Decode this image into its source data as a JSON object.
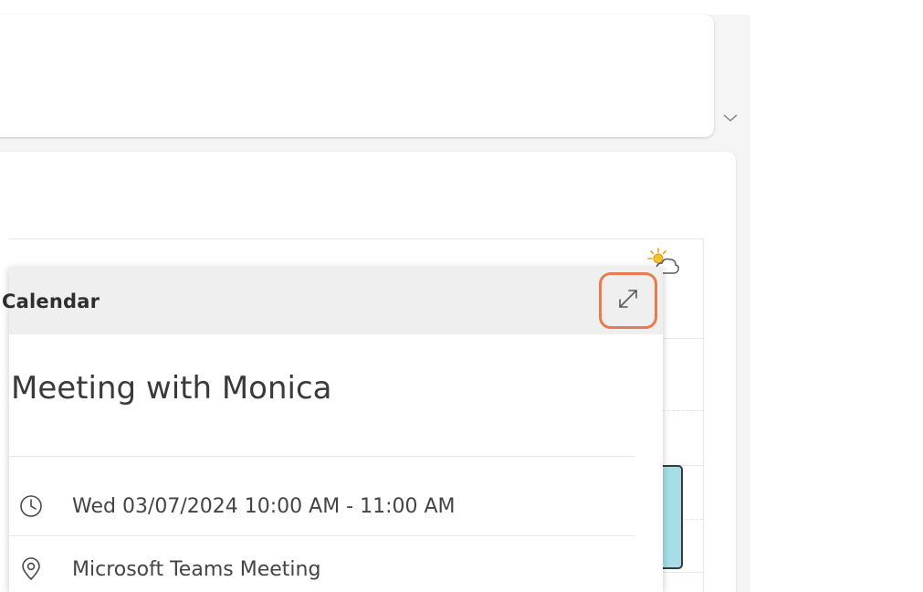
{
  "panel": {
    "header_title": "Calendar",
    "expand_label": "Expand"
  },
  "event": {
    "title": "Meeting with Monica",
    "datetime": "Wed 03/07/2024 10:00 AM - 11:00 AM",
    "location": "Microsoft Teams Meeting"
  },
  "icons": {
    "expand": "expand-diagonal-arrows-icon",
    "clock": "clock-icon",
    "location": "location-pin-icon",
    "weather": "partly-sunny-icon",
    "chevron": "chevron-down-icon"
  },
  "colors": {
    "highlight": "#ea7b4f",
    "event_block": "#a6dde6",
    "header_bg": "#efefef"
  }
}
